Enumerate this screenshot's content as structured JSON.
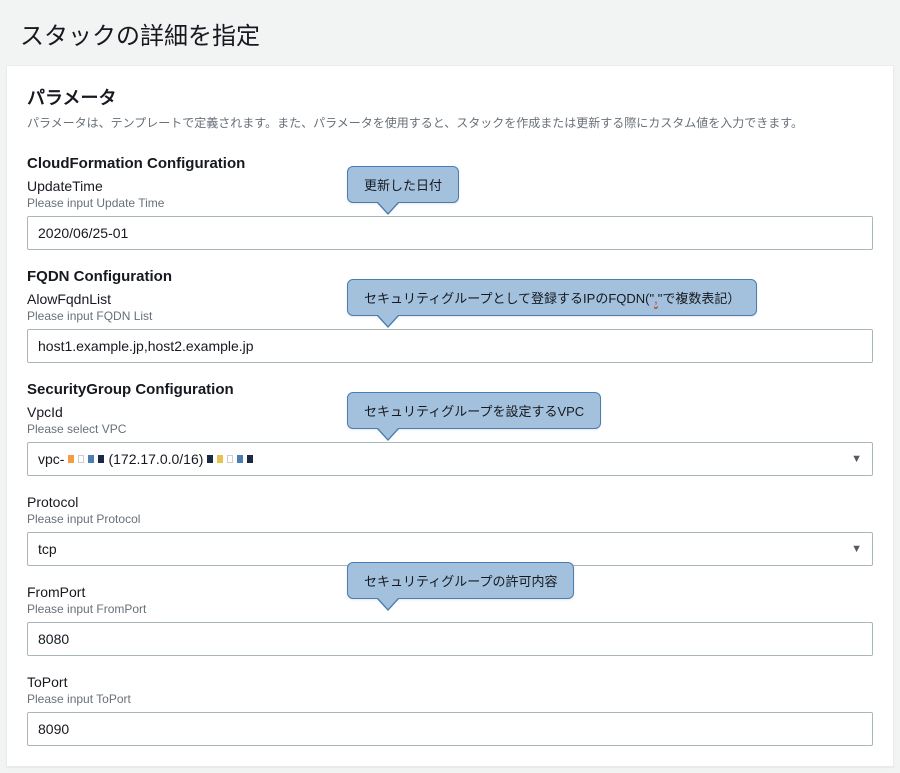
{
  "page": {
    "title": "スタックの詳細を指定"
  },
  "parameters": {
    "heading": "パラメータ",
    "subtext": "パラメータは、テンプレートで定義されます。また、パラメータを使用すると、スタックを作成または更新する際にカスタム値を入力できます。"
  },
  "sections": {
    "cloudformation": {
      "title": "CloudFormation Configuration",
      "updateTime": {
        "label": "UpdateTime",
        "hint": "Please input Update Time",
        "value": "2020/06/25-01",
        "callout": "更新した日付"
      }
    },
    "fqdn": {
      "title": "FQDN Configuration",
      "allowFqdnList": {
        "label": "AlowFqdnList",
        "hint": "Please input FQDN List",
        "value": "host1.example.jp,host2.example.jp",
        "callout_prefix": "セキュリティグループとして登録するIPのFQDN(\"",
        "callout_mid": ",",
        "callout_suffix": "\"で複数表記）"
      }
    },
    "sg": {
      "title": "SecurityGroup Configuration",
      "vpcId": {
        "label": "VpcId",
        "hint": "Please select VPC",
        "value_prefix": "vpc-",
        "value_cidr": "(172.17.0.0/16)",
        "callout": "セキュリティグループを設定するVPC"
      },
      "protocol": {
        "label": "Protocol",
        "hint": "Please input Protocol",
        "value": "tcp"
      },
      "fromPort": {
        "label": "FromPort",
        "hint": "Please input FromPort",
        "value": "8080",
        "callout": "セキュリティグループの許可内容"
      },
      "toPort": {
        "label": "ToPort",
        "hint": "Please input ToPort",
        "value": "8090"
      }
    }
  }
}
